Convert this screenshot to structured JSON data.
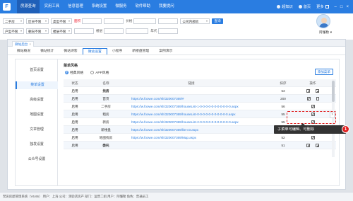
{
  "nav": {
    "items": [
      "房源查询",
      "实用工具",
      "信息管理",
      "系统设置",
      "微服务",
      "软件帮助",
      "我要提问"
    ],
    "right": {
      "sync": "超知识",
      "home": "首页",
      "more": "更多"
    }
  },
  "filters": {
    "row1": {
      "select1": "二手房",
      "select2": "区县不限",
      "select3": "类型不限",
      "name_label": "面积",
      "price_label": "价格",
      "select4": "公司内部房",
      "button": "查询"
    },
    "row2": {
      "select1": "户型不限",
      "select2": "朝向不限",
      "select3": "楼层不限",
      "floor_label": "楼层",
      "year_label": "年代"
    }
  },
  "user": {
    "name": "阿懂勒"
  },
  "window": {
    "tab": {
      "label": "微站后台",
      "close": "×"
    },
    "subtabs": [
      "微站概况",
      "微站统计",
      "微站诗客",
      "微站设置",
      "小程序",
      "新楼盘管理",
      "案例演示"
    ]
  },
  "side": {
    "items": [
      "首页设置",
      "菜单设置",
      "高级设置",
      "地图设置",
      "文章管理",
      "独发设置",
      "公众号设置"
    ]
  },
  "menu": {
    "title": "菜单风格",
    "styles": [
      "经典风格",
      "APP风格"
    ],
    "add_button": "添加菜单",
    "columns": [
      "状态",
      "名称",
      "链接",
      "排序",
      "操作"
    ],
    "rows": [
      {
        "status": "启用",
        "name": "找房",
        "link": "",
        "sort": "53",
        "bold": true
      },
      {
        "status": "启用",
        "name": "首页",
        "link": "https://w.foowe.com/sh/320007369/#",
        "sort": "200"
      },
      {
        "status": "启用",
        "name": "二手房",
        "link": "https://w.foowe.com/sh/320007369/houseList-1-0-0-0-0-0-0-0-0-0-0-0.aspx",
        "sort": "56"
      },
      {
        "status": "启用",
        "name": "租房",
        "link": "https://w.foowe.com/sh/320007369/houseList-0-0-0-0-0-0-0-0-0-0-0.aspx",
        "sort": "55"
      },
      {
        "status": "启用",
        "name": "新房",
        "link": "https://w.foowe.com/sh/320007369/houseList-2-0-0-0-0-0-0-0-0-0-0-0.aspx",
        "sort": "55"
      },
      {
        "status": "启用",
        "name": "新楼盘",
        "link": "https://w.foowe.com/sh/320007369/list-c0.aspx",
        "sort": "53"
      },
      {
        "status": "启用",
        "name": "地图找房",
        "link": "https://w.foowe.com/sh/320007369/Map.aspx",
        "sort": "52"
      },
      {
        "status": "启用",
        "name": "委托",
        "link": "",
        "sort": "51",
        "bold": true
      }
    ]
  },
  "annotation": {
    "tooltip": "子菜单可编辑、可删除",
    "badge": "1"
  },
  "status": {
    "text": "梵讯房屋管理系统（V6.66）  用户：上海  公司：测验店房产  部门：运营二组  用户：阿懂勒  角色：普通员工"
  }
}
